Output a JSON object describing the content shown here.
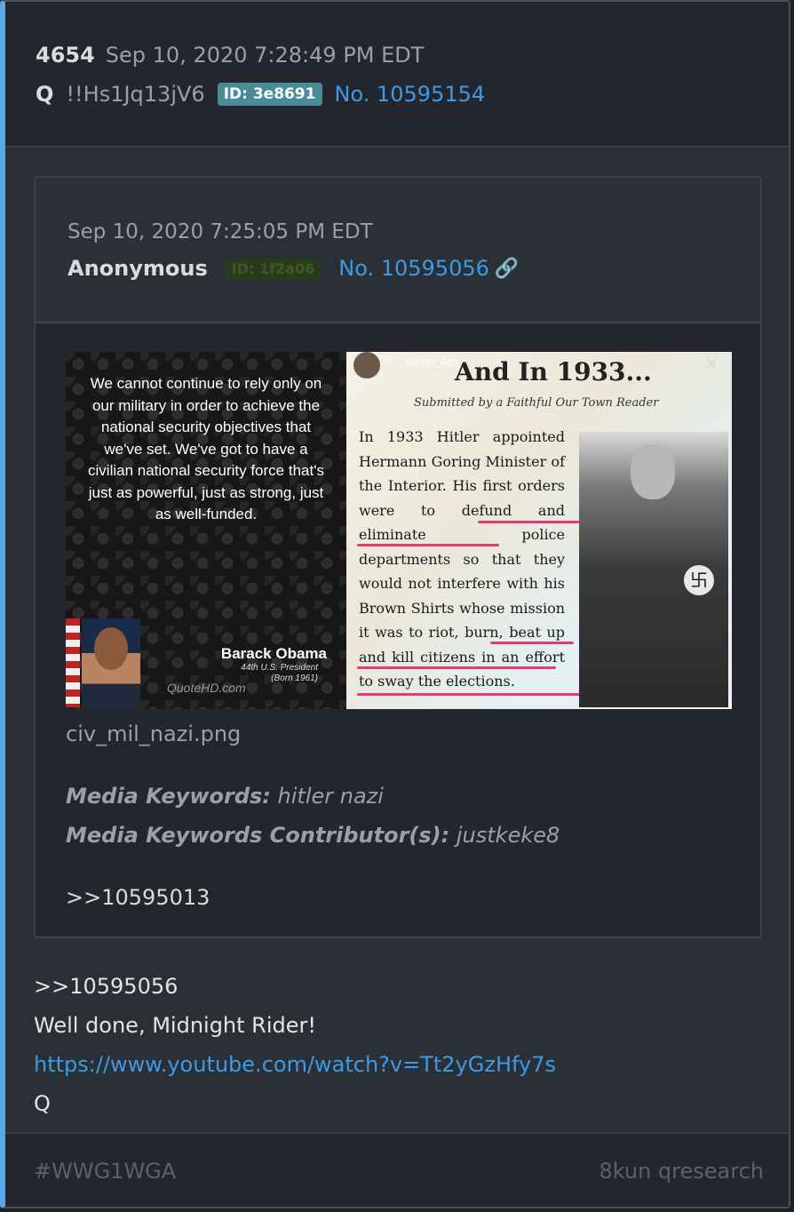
{
  "post": {
    "number": "4654",
    "date": "Sep 10, 2020 7:28:49 PM EDT",
    "name": "Q",
    "tripcode": "!!Hs1Jq13jV6",
    "id_badge": "ID: 3e8691",
    "post_no": "No. 10595154"
  },
  "quoted": {
    "date": "Sep 10, 2020 7:25:05 PM EDT",
    "name": "Anonymous",
    "id_badge": "ID: 1f2a06",
    "post_no": "No. 10595056",
    "image": {
      "quote_text": "We cannot continue to rely only on our military in order to achieve the national security objectives that we've set. We've got to have a civilian national security force that's just as powerful, just as strong, just as well-funded.",
      "speaker": "Barack Obama",
      "speaker_title": "44th U.S. President",
      "speaker_born": "(Born 1961)",
      "watermark": "QuoteHD.com",
      "ig_user": "arinan_4gs",
      "article_title": "And In 1933...",
      "article_sub": "Submitted by a Faithful Our Town Reader",
      "article_body": "In 1933 Hitler appointed Hermann Goring Minister of the Interior. His first orders were to defund and eliminate police departments so that they would not interfere with his Brown Shirts whose mission it was to riot, burn, beat up and kill citizens in an effort to sway the elections."
    },
    "filename": "civ_mil_nazi.png",
    "keywords_label": "Media Keywords:",
    "keywords": "hitler nazi",
    "contributor_label": "Media Keywords Contributor(s):",
    "contributor": "justkeke8",
    "reply_ref": ">>10595013"
  },
  "body": {
    "reply_ref": ">>10595056",
    "line1": "Well done, Midnight Rider!",
    "link": "https://www.youtube.com/watch?v=Tt2yGzHfy7s",
    "signature": "Q"
  },
  "footer": {
    "hashtag": "#WWG1WGA",
    "source": "8kun qresearch"
  },
  "icons": {
    "link": "link-icon",
    "close": "close-icon"
  },
  "colors": {
    "accent": "#5da8e8",
    "link": "#3d9ae6",
    "id_badge_bg": "#4a8b96",
    "highlight_red": "#e23a7a"
  }
}
